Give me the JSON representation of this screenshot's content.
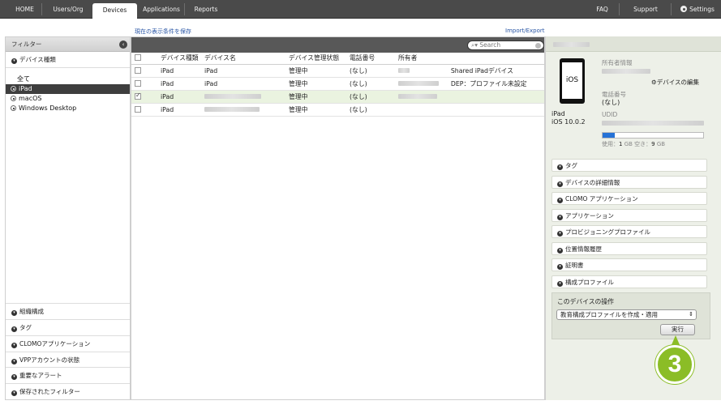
{
  "nav": {
    "tabs": [
      "HOME",
      "Users/Org",
      "Devices",
      "Applications",
      "Reports"
    ],
    "active": "Devices",
    "right": [
      "FAQ",
      "Support",
      "Settings"
    ]
  },
  "links": {
    "save_filter": "現在の表示条件を保存",
    "import_export": "Import/Export"
  },
  "sidebar": {
    "title": "フィルター",
    "device_type_section": "デバイス種類",
    "all": "全て",
    "device_types": [
      "iPad",
      "macOS",
      "Windows Desktop"
    ],
    "selected_type": "iPad",
    "bottom_sections": [
      "組織構成",
      "タグ",
      "CLOMOアプリケーション",
      "VPPアカウントの状態",
      "重要なアラート",
      "保存されたフィルター"
    ]
  },
  "table": {
    "search_placeholder": "Search",
    "columns": [
      "デバイス種類",
      "デバイス名",
      "デバイス管理状態",
      "電話番号",
      "所有者"
    ],
    "rows": [
      {
        "type": "iPad",
        "name": "iPad",
        "status": "管理中",
        "phone": "(なし)",
        "note": "Shared iPadデバイス",
        "checked": false
      },
      {
        "type": "iPad",
        "name": "iPad",
        "status": "管理中",
        "phone": "(なし)",
        "note": "DEP：プロファイル未設定",
        "checked": false
      },
      {
        "type": "iPad",
        "name": "",
        "status": "管理中",
        "phone": "(なし)",
        "note": "",
        "checked": true
      },
      {
        "type": "iPad",
        "name": "",
        "status": "管理中",
        "phone": "(なし)",
        "note": "",
        "checked": false
      }
    ]
  },
  "detail": {
    "device_model": "iPad",
    "os_version": "iOS 10.0.2",
    "icon_text": "iOS",
    "owner_label": "所有者情報",
    "edit_device": "デバイスの編集",
    "phone_label": "電話番号",
    "phone_value": "(なし)",
    "udid_label": "UDID",
    "storage": {
      "used_label": "使用：",
      "used": "1",
      "free_label": "空き：",
      "free": "9",
      "unit": "GB",
      "fraction_used": 0.12
    },
    "sections": [
      "タグ",
      "デバイスの詳細情報",
      "CLOMO アプリケーション",
      "アプリケーション",
      "プロビジョニングプロファイル",
      "位置情報履歴",
      "証明書",
      "構成プロファイル"
    ],
    "ops_title": "このデバイスの操作",
    "ops_selected": "教育構成プロファイルを作成・適用",
    "run": "実行"
  },
  "step_badge": "3"
}
